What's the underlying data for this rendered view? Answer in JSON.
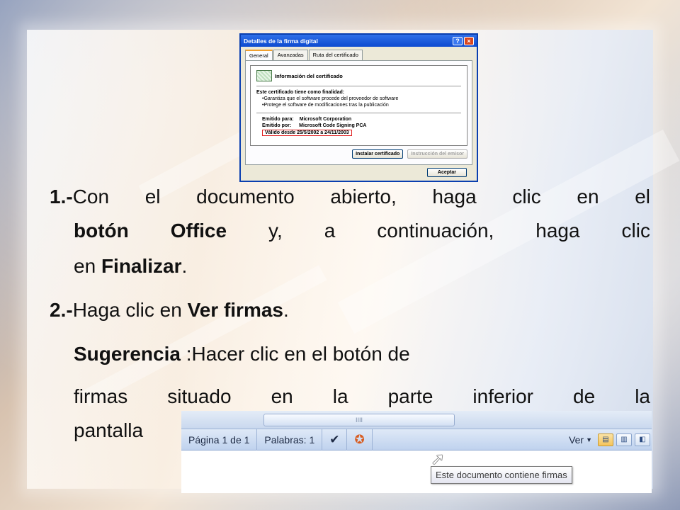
{
  "dialog": {
    "title": "Detalles de la firma digital",
    "help_btn": "?",
    "close_btn": "×",
    "tabs": [
      "General",
      "Avanzadas",
      "Ruta del certificado"
    ],
    "cert_info_title": "Información del certificado",
    "purpose_heading": "Este certificado tiene como finalidad:",
    "purposes": [
      "•Garantiza que el software procede del proveedor de software",
      "•Protege el software de modificaciones tras la publicación"
    ],
    "issued_to_label": "Emitido para:",
    "issued_to_value": "Microsoft Corporation",
    "issued_by_label": "Emitido por:",
    "issued_by_value": "Microsoft Code Signing PCA",
    "validity": "Válido desde 25/5/2002 a 24/11/2003",
    "install_btn": "Instalar certificado",
    "issuer_btn": "Instrucción del emisor",
    "ok_btn": "Aceptar"
  },
  "steps": {
    "s1_num": "1.-",
    "s1_a": "Con el documento abierto, haga clic en el",
    "s1_b_bold": "botón Office",
    "s1_b": " y, a continuación, haga clic",
    "s1_c": "en ",
    "s1_c_bold": "Finalizar",
    "s1_c_end": ".",
    "s2_num": "2.-",
    "s2_a": "Haga clic en ",
    "s2_bold": "Ver firmas",
    "s2_end": ".",
    "tip_bold": "Sugerencia",
    "tip_rest": " :Hacer clic en el botón de",
    "tip_line2": "firmas situado en la parte inferior de la",
    "tip_line3": "pantalla"
  },
  "statusbar": {
    "page": "Página 1 de 1",
    "words": "Palabras: 1",
    "view": "Ver",
    "tooltip": "Este documento contiene firmas",
    "scroll_grip": "IIII"
  }
}
